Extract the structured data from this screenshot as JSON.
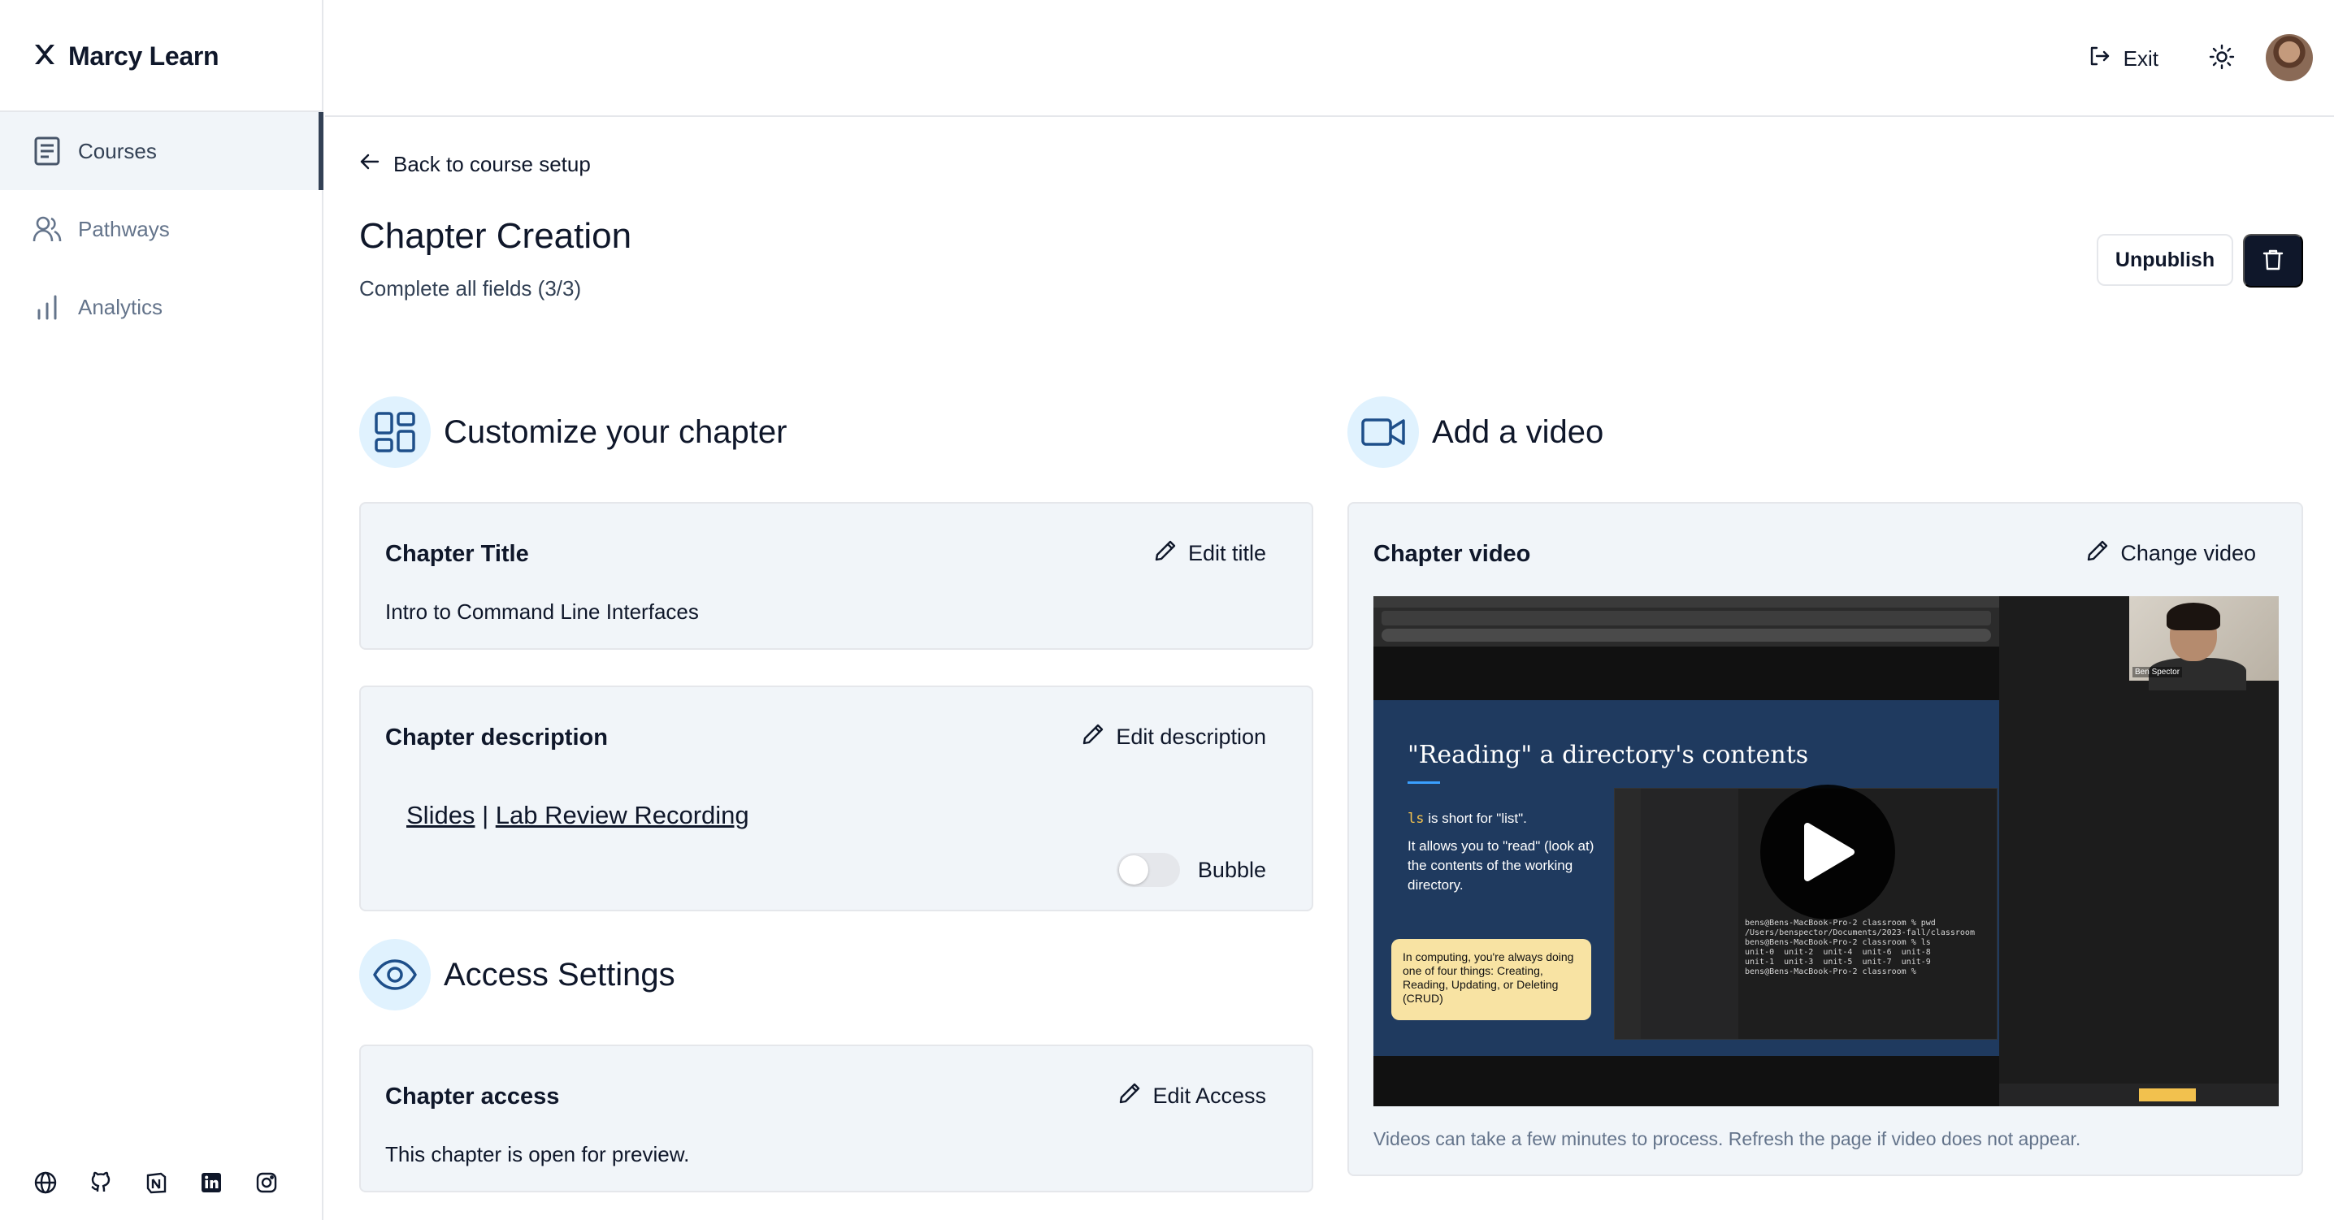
{
  "app": {
    "name": "Marcy Learn"
  },
  "sidebar": {
    "items": [
      {
        "label": "Courses",
        "icon": "book-icon",
        "active": true
      },
      {
        "label": "Pathways",
        "icon": "users-icon",
        "active": false
      },
      {
        "label": "Analytics",
        "icon": "bar-chart-icon",
        "active": false
      }
    ],
    "footer_icons": [
      "globe-icon",
      "github-icon",
      "notion-icon",
      "linkedin-icon",
      "instagram-icon"
    ]
  },
  "header": {
    "exit_label": "Exit"
  },
  "page": {
    "back_label": "Back to course setup",
    "title": "Chapter Creation",
    "subtitle": "Complete all fields (3/3)",
    "unpublish_label": "Unpublish"
  },
  "customize": {
    "heading": "Customize your chapter",
    "title_card": {
      "label": "Chapter Title",
      "action": "Edit title",
      "value": "Intro to Command Line Interfaces"
    },
    "description_card": {
      "label": "Chapter description",
      "action": "Edit description",
      "link1": "Slides",
      "separator": "|",
      "link2": "Lab Review Recording",
      "toggle_label": "Bubble",
      "toggle_on": false
    }
  },
  "access": {
    "heading": "Access Settings",
    "card": {
      "label": "Chapter access",
      "action": "Edit Access",
      "value": "This chapter is open for preview."
    }
  },
  "video": {
    "heading": "Add a video",
    "card": {
      "label": "Chapter video",
      "action": "Change video",
      "note": "Videos can take a few minutes to process. Refresh the page if video does not appear."
    },
    "thumbnail": {
      "slide_title": "\"Reading\" a directory's contents",
      "slide_cmd": "ls",
      "slide_line1": " is short for \"list\".",
      "slide_line2": "It allows you to \"read\" (look at) the contents of the working directory.",
      "slide_note": "In computing, you're always doing one of four things: Creating, Reading, Updating, or Deleting (CRUD)",
      "terminal": "bens@Bens-MacBook-Pro-2 classroom % pwd\n/Users/benspector/Documents/2023-fall/classroom\nbens@Bens-MacBook-Pro-2 classroom % ls\nunit-0  unit-2  unit-4  unit-6  unit-8\nunit-1  unit-3  unit-5  unit-7  unit-9\nbens@Bens-MacBook-Pro-2 classroom %",
      "cam_tag": "Ben Spector"
    }
  },
  "colors": {
    "accent": "#1e4f8a",
    "icon_bg": "#e0f2fe",
    "card_bg": "#f1f5f9",
    "dark": "#0f172a"
  }
}
